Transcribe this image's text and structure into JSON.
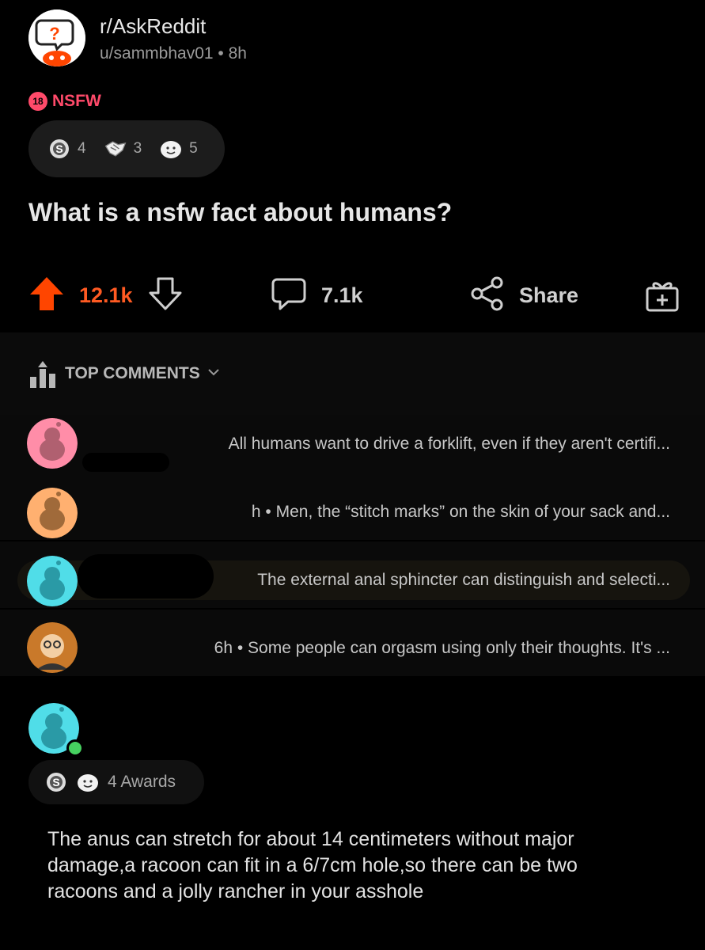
{
  "post": {
    "subreddit": "r/AskReddit",
    "author": "u/sammbhav01",
    "age": "8h",
    "nsfw_badge": "18",
    "nsfw_label": "NSFW",
    "awards": [
      {
        "icon": "silver-award-icon",
        "count": "4"
      },
      {
        "icon": "helpful-award-icon",
        "count": "3"
      },
      {
        "icon": "wholesome-award-icon",
        "count": "5"
      }
    ],
    "title": "What is a nsfw fact about humans?",
    "votes": "12.1k",
    "comments": "7.1k",
    "share_label": "Share"
  },
  "top_comments": {
    "label": "TOP COMMENTS",
    "items": [
      {
        "text": "All humans want to drive a forklift, even if they aren't certifi..."
      },
      {
        "text": "h • Men, the “stitch marks” on the skin of your sack and..."
      },
      {
        "text": "The external anal sphincter can distinguish and selecti..."
      },
      {
        "text": "6h • Some people can orgasm using only their thoughts. It's ..."
      }
    ]
  },
  "main_comment": {
    "awards_label": "4 Awards",
    "body": "The anus can stretch for about 14 centimeters without major damage,a racoon can fit in a 6/7cm hole,so there can be two racoons and a jolly rancher in your asshole"
  },
  "colors": {
    "upvote": "#ff4500",
    "nsfw": "#ff4a6a",
    "online": "#46d160"
  }
}
